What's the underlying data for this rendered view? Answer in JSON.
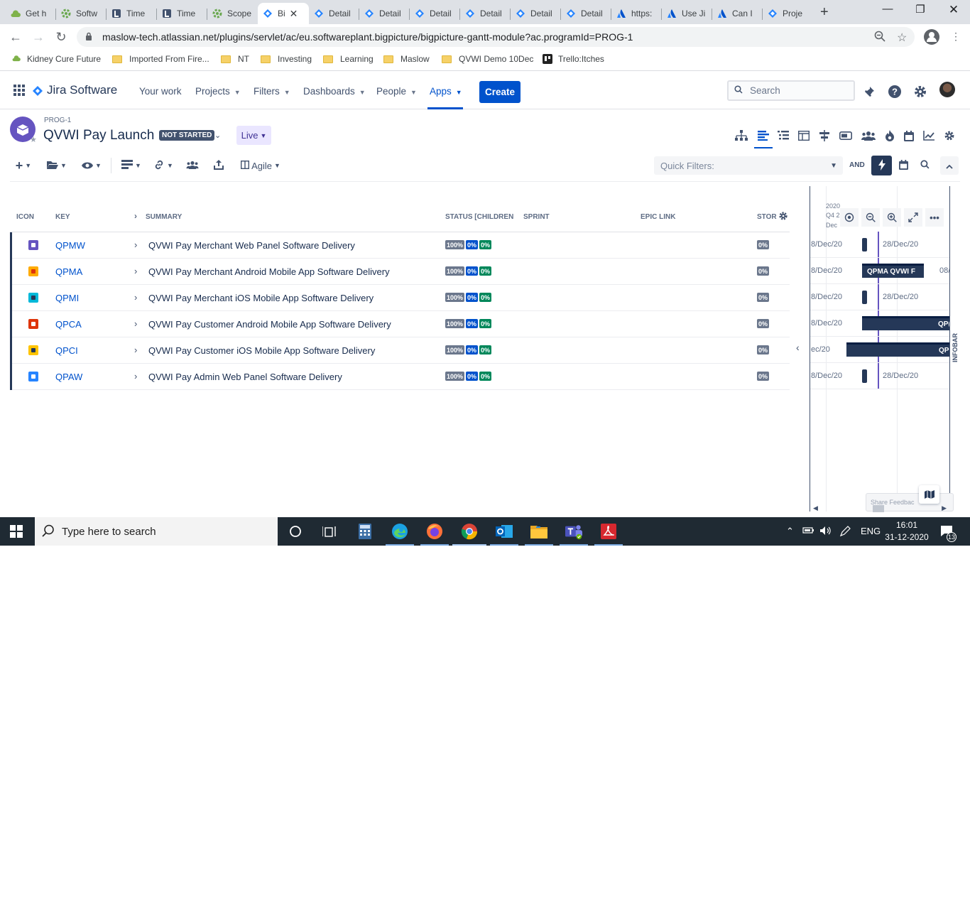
{
  "browser": {
    "tabs": [
      {
        "label": "Get h",
        "icon": "cloud-icon"
      },
      {
        "label": "Softw",
        "icon": "gear-green-icon"
      },
      {
        "label": "Time",
        "icon": "tempo-icon"
      },
      {
        "label": "Time",
        "icon": "tempo-icon"
      },
      {
        "label": "Scope",
        "icon": "gear-green-icon"
      },
      {
        "label": "Bi",
        "icon": "jira-diamond-icon"
      },
      {
        "label": "Detail",
        "icon": "jira-diamond-icon"
      },
      {
        "label": "Detail",
        "icon": "jira-diamond-icon"
      },
      {
        "label": "Detail",
        "icon": "jira-diamond-icon"
      },
      {
        "label": "Detail",
        "icon": "jira-diamond-icon"
      },
      {
        "label": "Detail",
        "icon": "jira-diamond-icon"
      },
      {
        "label": "Detail",
        "icon": "jira-diamond-icon"
      },
      {
        "label": "https:",
        "icon": "atlassian-icon"
      },
      {
        "label": "Use Ji",
        "icon": "atlassian-icon"
      },
      {
        "label": "Can I",
        "icon": "atlassian-icon"
      },
      {
        "label": "Proje",
        "icon": "jira-diamond-icon"
      }
    ],
    "url": "maslow-tech.atlassian.net/plugins/servlet/ac/eu.softwareplant.bigpicture/bigpicture-gantt-module?ac.programId=PROG-1",
    "bookmarks": [
      {
        "label": "Kidney Cure Future",
        "icon": "cloud-icon"
      },
      {
        "label": "Imported From Fire...",
        "icon": "folder-icon"
      },
      {
        "label": "NT",
        "icon": "folder-icon"
      },
      {
        "label": "Investing",
        "icon": "folder-icon"
      },
      {
        "label": "Learning",
        "icon": "folder-icon"
      },
      {
        "label": "Maslow",
        "icon": "folder-icon"
      },
      {
        "label": "QVWI Demo 10Dec",
        "icon": "folder-icon"
      },
      {
        "label": "Trello:Itches",
        "icon": "trello-icon"
      }
    ]
  },
  "jira": {
    "product": "Jira Software",
    "nav": [
      {
        "label": "Your work",
        "dropdown": false
      },
      {
        "label": "Projects",
        "dropdown": true
      },
      {
        "label": "Filters",
        "dropdown": true
      },
      {
        "label": "Dashboards",
        "dropdown": true
      },
      {
        "label": "People",
        "dropdown": true
      },
      {
        "label": "Apps",
        "dropdown": true,
        "active": true
      }
    ],
    "create_label": "Create",
    "search_placeholder": "Search"
  },
  "program": {
    "key": "PROG-1",
    "title": "QVWI Pay Launch",
    "status": "NOT STARTED",
    "mode": "Live",
    "quick_filters_placeholder": "Quick Filters:",
    "and_label": "AND",
    "view_label": "Agile"
  },
  "table": {
    "columns": {
      "icon": "ICON",
      "key": "KEY",
      "summary": "SUMMARY",
      "status": "STATUS [CHILDREN",
      "sprint": "SPRINT",
      "epic_link": "EPIC LINK",
      "story": "STOR"
    },
    "rows": [
      {
        "key": "QPMW",
        "summary": "QVWI Pay Merchant Web Panel Software Delivery",
        "done": "100%",
        "in_progress": "0%",
        "todo": "0%",
        "story": "0%",
        "icon_color": "#6554c0"
      },
      {
        "key": "QPMA",
        "summary": "QVWI Pay Merchant Android Mobile App Software Delivery",
        "done": "100%",
        "in_progress": "0%",
        "todo": "0%",
        "story": "0%",
        "icon_color": "#ffab00"
      },
      {
        "key": "QPMI",
        "summary": "QVWI Pay Merchant iOS Mobile App Software Delivery",
        "done": "100%",
        "in_progress": "0%",
        "todo": "0%",
        "story": "0%",
        "icon_color": "#00b8d9"
      },
      {
        "key": "QPCA",
        "summary": "QVWI Pay Customer Android Mobile App Software Delivery",
        "done": "100%",
        "in_progress": "0%",
        "todo": "0%",
        "story": "0%",
        "icon_color": "#de350b"
      },
      {
        "key": "QPCI",
        "summary": "QVWI Pay Customer iOS Mobile App Software Delivery",
        "done": "100%",
        "in_progress": "0%",
        "todo": "0%",
        "story": "0%",
        "icon_color": "#ffc400"
      },
      {
        "key": "QPAW",
        "summary": "QVWI Pay Admin Web Panel Software Delivery",
        "done": "100%",
        "in_progress": "0%",
        "todo": "0%",
        "story": "0%",
        "icon_color": "#2684ff"
      }
    ]
  },
  "gantt": {
    "year": "2020",
    "quarter": "Q4 2",
    "month": "Dec",
    "rows": [
      {
        "left_date": "8/Dec/20",
        "right_date": "28/Dec/20",
        "bar_label": ""
      },
      {
        "left_date": "8/Dec/20",
        "right_date": "08/",
        "bar_label": "QPMA   QVWI F"
      },
      {
        "left_date": "8/Dec/20",
        "right_date": "28/Dec/20",
        "bar_label": ""
      },
      {
        "left_date": "8/Dec/20",
        "right_date": "",
        "bar_label": "QP("
      },
      {
        "left_date": "ec/20",
        "right_date": "",
        "bar_label": "QP"
      },
      {
        "left_date": "8/Dec/20",
        "right_date": "28/Dec/20",
        "bar_label": ""
      }
    ],
    "infobar_label": "INFOBAR",
    "feedback_label": "Share Feedbac"
  },
  "taskbar": {
    "search_placeholder": "Type here to search",
    "language": "ENG",
    "time": "16:01",
    "date": "31-12-2020",
    "notification_count": "13"
  },
  "colors": {
    "jira_blue": "#0052cc",
    "program_purple": "#6554c0",
    "done_gray": "#6b778c",
    "in_progress_blue": "#0052cc",
    "todo_green": "#00875a"
  }
}
